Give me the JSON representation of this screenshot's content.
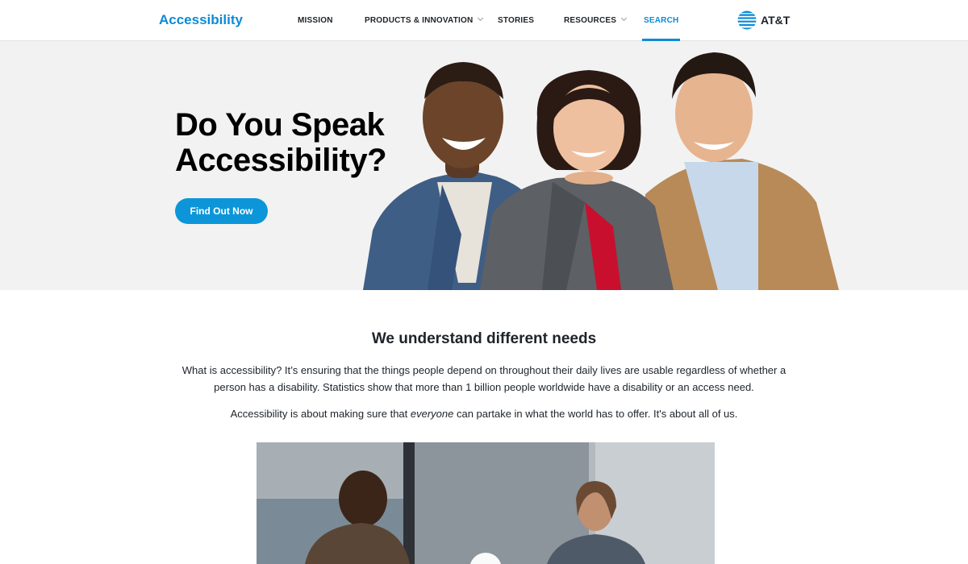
{
  "header": {
    "brand": "Accessibility",
    "nav": [
      {
        "label": "MISSION",
        "has_dropdown": false,
        "active": false
      },
      {
        "label": "PRODUCTS & INNOVATION",
        "has_dropdown": true,
        "active": false
      },
      {
        "label": "STORIES",
        "has_dropdown": false,
        "active": false
      },
      {
        "label": "RESOURCES",
        "has_dropdown": true,
        "active": false
      },
      {
        "label": "SEARCH",
        "has_dropdown": false,
        "active": true
      }
    ],
    "logo_text": "AT&T"
  },
  "hero": {
    "title_line1": "Do You Speak",
    "title_line2": "Accessibility?",
    "cta_label": "Find Out Now"
  },
  "intro": {
    "title": "We understand different needs",
    "paragraph1": "What is accessibility? It’s ensuring that the things people depend on throughout their daily lives are usable regardless of whether a person has a disability. Statistics show that more than 1 billion people worldwide have a disability or an access need.",
    "paragraph2_before": "Accessibility is about making sure that ",
    "paragraph2_em": "everyone",
    "paragraph2_after": " can partake in what the world has to offer. It's about all of us."
  },
  "colors": {
    "accent": "#0c8bd6",
    "button": "#0c96d9",
    "hero_bg": "#f2f2f2",
    "text": "#1d2329"
  },
  "icons": {
    "dropdown": "chevron-down-icon",
    "logo": "att-globe-icon",
    "video": "play-icon"
  }
}
